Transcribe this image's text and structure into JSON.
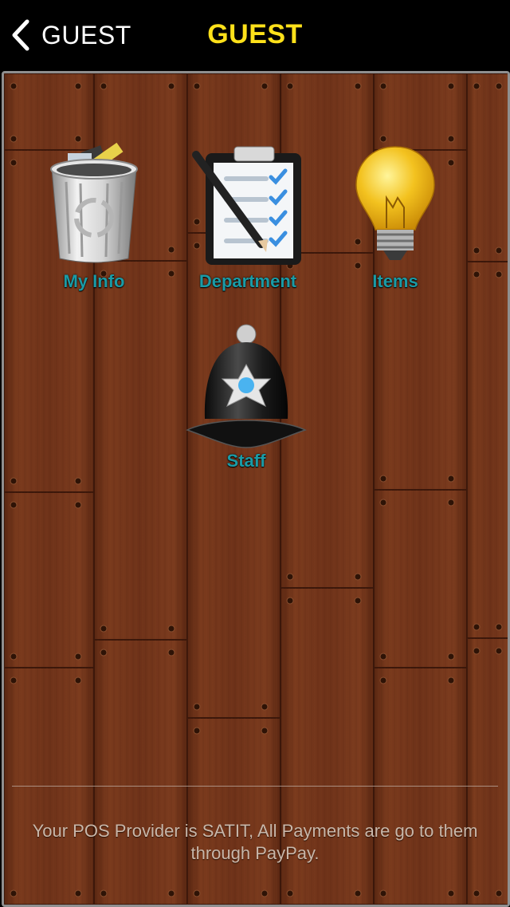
{
  "navbar": {
    "back_label": "GUEST",
    "title": "GUEST",
    "title_color": "#ffe11a"
  },
  "menu": [
    {
      "label": "My Info",
      "icon": "trash-can-icon"
    },
    {
      "label": "Department",
      "icon": "clipboard-checklist-icon"
    },
    {
      "label": "Items",
      "icon": "light-bulb-icon"
    },
    {
      "label": "Staff",
      "icon": "police-helmet-icon"
    }
  ],
  "footer": {
    "text": "Your POS Provider is SATIT, All Payments are go to them through PayPay."
  },
  "colors": {
    "label": "#1a9ba6",
    "wood": "#6a3017",
    "frame": "#8f8f8f"
  }
}
